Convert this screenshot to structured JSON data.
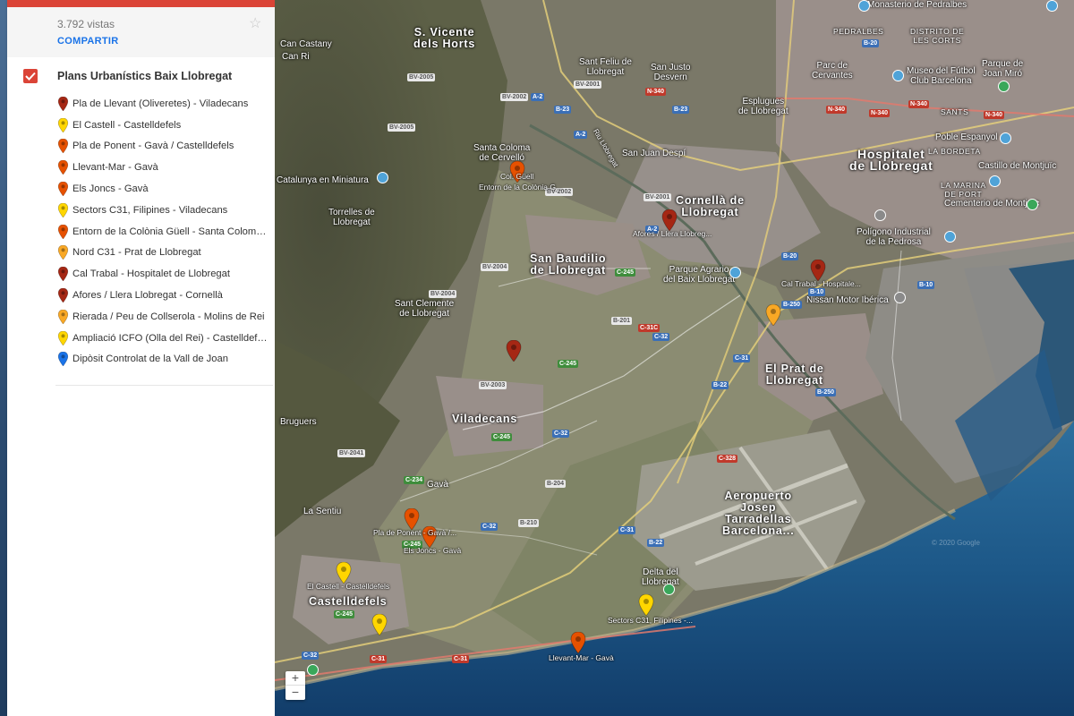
{
  "panel": {
    "views": "3.792 vistas",
    "share_label": "COMPARTIR",
    "layer": {
      "title": "Plans Urbanístics Baix Llobregat",
      "checked": true,
      "check_color": "#db4437"
    },
    "places": [
      {
        "label": "Pla de Llevant (Oliveretes) - Viladecans",
        "color": "#a52714"
      },
      {
        "label": "El Castell - Castelldefels",
        "color": "#ffd600"
      },
      {
        "label": "Pla de Ponent - Gavà / Castelldefels",
        "color": "#e65100"
      },
      {
        "label": "Llevant-Mar - Gavà",
        "color": "#e65100"
      },
      {
        "label": "Els Joncs - Gavà",
        "color": "#e65100"
      },
      {
        "label": "Sectors C31, Filipines - Viladecans",
        "color": "#ffd600"
      },
      {
        "label": "Entorn de la Colònia Güell - Santa Coloma / ...",
        "color": "#e65100"
      },
      {
        "label": "Nord C31 - Prat de Llobregat",
        "color": "#f9a825"
      },
      {
        "label": "Cal Trabal - Hospitalet de Llobregat",
        "color": "#a52714"
      },
      {
        "label": "Afores / Llera Llobregat - Cornellà",
        "color": "#a52714"
      },
      {
        "label": "Rierada / Peu de Collserola - Molins de Rei",
        "color": "#f9a825"
      },
      {
        "label": "Ampliació ICFO (Olla del Rei) - Castelldefels",
        "color": "#ffd600"
      },
      {
        "label": "Dipòsit Controlat de la Vall de Joan",
        "color": "#1a73e8"
      }
    ]
  },
  "map": {
    "labels": {
      "svh": "S. Vicente\ndels Horts",
      "sbl": "San Baudilio\nde Llobregat",
      "cornella": "Cornellà de\nLlobregat",
      "hospitalet": "Hospitalet\nde Llobregat",
      "prat": "El Prat de\nLlobregat",
      "viladecans": "Viladecans",
      "castelldefels": "Castelldefels",
      "gava": "Gavà",
      "aeropuerto": "Aeropuerto\nJosep\nTarradellas\nBarcelona...",
      "pedralbes": "PEDRALBES",
      "les_corts": "DISTRITO DE\nLES CORTS",
      "sants": "SANTS",
      "bordeta": "LA BORDETA",
      "marina": "LA MARINA\nDE PORT",
      "esplugues": "Esplugues\nde Llobregat",
      "sjd": "San Justo\nDesvern",
      "sfl": "Sant Feliu de\nLlobregat",
      "can_castany": "Can Castany",
      "can_ri": "Can Ri",
      "torrelles": "Torrelles de\nLlobregat",
      "catalunya_min": "Catalunya en Miniatura",
      "santa_coloma": "Santa Coloma\nde Cervelló",
      "sjdespi": "San Juan Despí",
      "sant_clemente": "Sant Clemente\nde Llobregat",
      "bruguers": "Bruguers",
      "la_sentiu": "La Sentiu",
      "parque_agrario": "Parque Agrario\ndel Baix Llobregat",
      "nissan": "Nissan Motor Ibérica",
      "poligono": "Polígono Industrial\nde la Pedrosa",
      "museo_futbol": "Museo del Fútbol\nClub Barcelona",
      "parque_miro": "Parque de\nJoan Miró",
      "pueblo_espanyol": "Poble Espanyol",
      "castillo": "Castillo de Montjuïc",
      "cementerio": "Cementerio de Montjuïc",
      "parc_cervantes": "Parc de\nCervantes",
      "delta": "Delta del\nLlobregat",
      "monasterio": "Monasterio de Pedralbes",
      "rio": "Riu Llobregat",
      "copyright": "© 2020 Google"
    },
    "pins": {
      "col_guell": "Col. Güell",
      "entorn": "Entorn de la Colònia G...",
      "afores": "Afores / Llera Llobreg...",
      "cal_trabal": "Cal Trabal - Hospitale...",
      "pla_ponent": "Pla de Ponent - Gavà /...",
      "els_joncs": "Els Joncs - Gavà",
      "el_castell": "El Castell - Castelldefels",
      "sectors": "Sectors C31, Filipines -...",
      "llevant_mar": "Llevant-Mar - Gavà"
    },
    "roads": {
      "bv2005": "BV-2005",
      "bv2002": "BV-2002",
      "bv2001": "BV-2001",
      "bv2004": "BV-2004",
      "bv2003": "BV-2003",
      "bv2041": "BV-2041",
      "a2": "A-2",
      "b23": "B-23",
      "n340": "N-340",
      "b20": "B-20",
      "b10": "B-10",
      "b250": "B-250",
      "b22": "B-22",
      "c31": "C-31",
      "c32": "C-32",
      "c245": "C-245",
      "b210": "B-210",
      "b204": "B-204",
      "c234": "C-234",
      "b201": "B-201",
      "c328": "C-328",
      "c31c": "C-31C"
    },
    "zoom_in": "+",
    "zoom_out": "−"
  }
}
